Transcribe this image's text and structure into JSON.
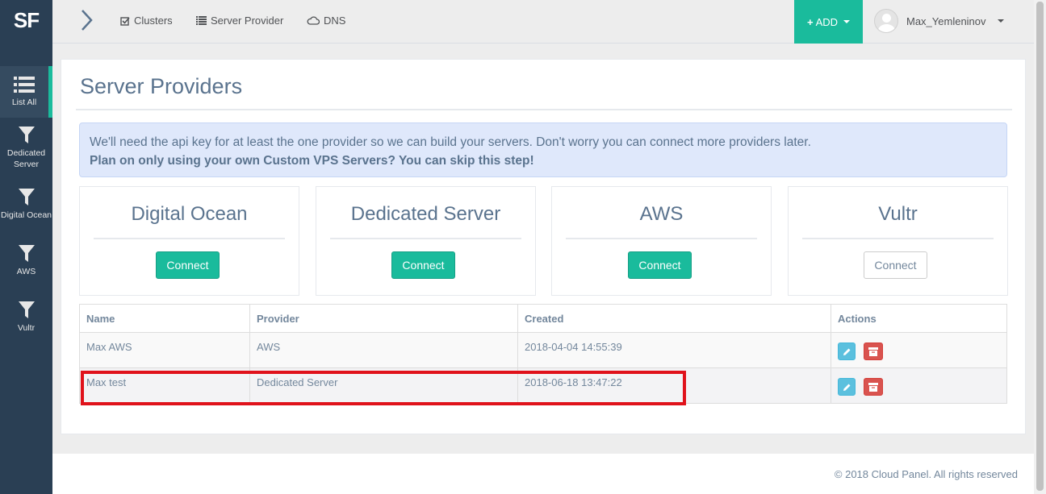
{
  "brand": "SF",
  "sidebar": {
    "items": [
      {
        "label": "List All",
        "icon": "list-icon"
      },
      {
        "label": "Dedicated Server",
        "icon": "filter-icon"
      },
      {
        "label": "Digital Ocean",
        "icon": "filter-icon"
      },
      {
        "label": "AWS",
        "icon": "filter-icon"
      },
      {
        "label": "Vultr",
        "icon": "filter-icon"
      }
    ]
  },
  "topnav": {
    "links": [
      {
        "label": "Clusters",
        "icon": "check-square-icon"
      },
      {
        "label": "Server Provider",
        "icon": "list-icon"
      },
      {
        "label": "DNS",
        "icon": "cloud-icon"
      }
    ],
    "add_label": "ADD",
    "user_name": "Max_Yemleninov"
  },
  "page": {
    "title": "Server Providers",
    "alert_line1": "We'll need the api key for at least the one provider so we can build your servers. Don't worry you can connect more providers later.",
    "alert_line2": "Plan on only using your own Custom VPS Servers? You can skip this step!"
  },
  "providers": [
    {
      "name": "Digital Ocean",
      "button": "Connect",
      "state": "primary"
    },
    {
      "name": "Dedicated Server",
      "button": "Connect",
      "state": "primary"
    },
    {
      "name": "AWS",
      "button": "Connect",
      "state": "primary"
    },
    {
      "name": "Vultr",
      "button": "Connect",
      "state": "default"
    }
  ],
  "table": {
    "headers": [
      "Name",
      "Provider",
      "Created",
      "Actions"
    ],
    "rows": [
      {
        "name": "Max AWS",
        "provider": "AWS",
        "created": "2018-04-04 14:55:39"
      },
      {
        "name": "Max test",
        "provider": "Dedicated Server",
        "created": "2018-06-18 13:47:22"
      }
    ]
  },
  "colors": {
    "accent": "#1abb9c",
    "sidebar": "#2a3f54",
    "highlight": "#e0121b",
    "edit": "#5bc0de",
    "delete": "#d9534f"
  },
  "footer": "© 2018 Cloud Panel. All rights reserved"
}
